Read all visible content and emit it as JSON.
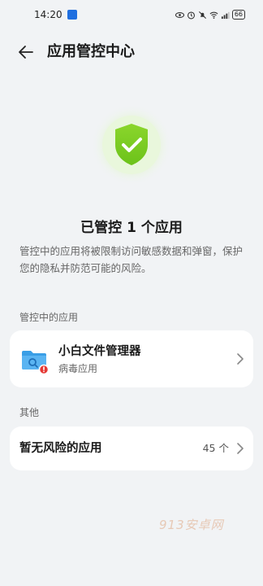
{
  "status_bar": {
    "time": "14:20",
    "battery": "66"
  },
  "header": {
    "title": "应用管控中心"
  },
  "summary": {
    "title": "已管控 1 个应用",
    "description": "管控中的应用将被限制访问敏感数据和弹窗，保护您的隐私并防范可能的风险。"
  },
  "controlled_section": {
    "label": "管控中的应用",
    "apps": [
      {
        "name": "小白文件管理器",
        "subtitle": "病毒应用",
        "icon": "folder-virus-icon"
      }
    ]
  },
  "other_section": {
    "label": "其他",
    "row": {
      "label": "暂无风险的应用",
      "count": "45 个"
    }
  },
  "watermark": "913安卓网",
  "colors": {
    "shield_green": "#7ed321",
    "background": "#f1f3f5",
    "card": "#ffffff"
  }
}
